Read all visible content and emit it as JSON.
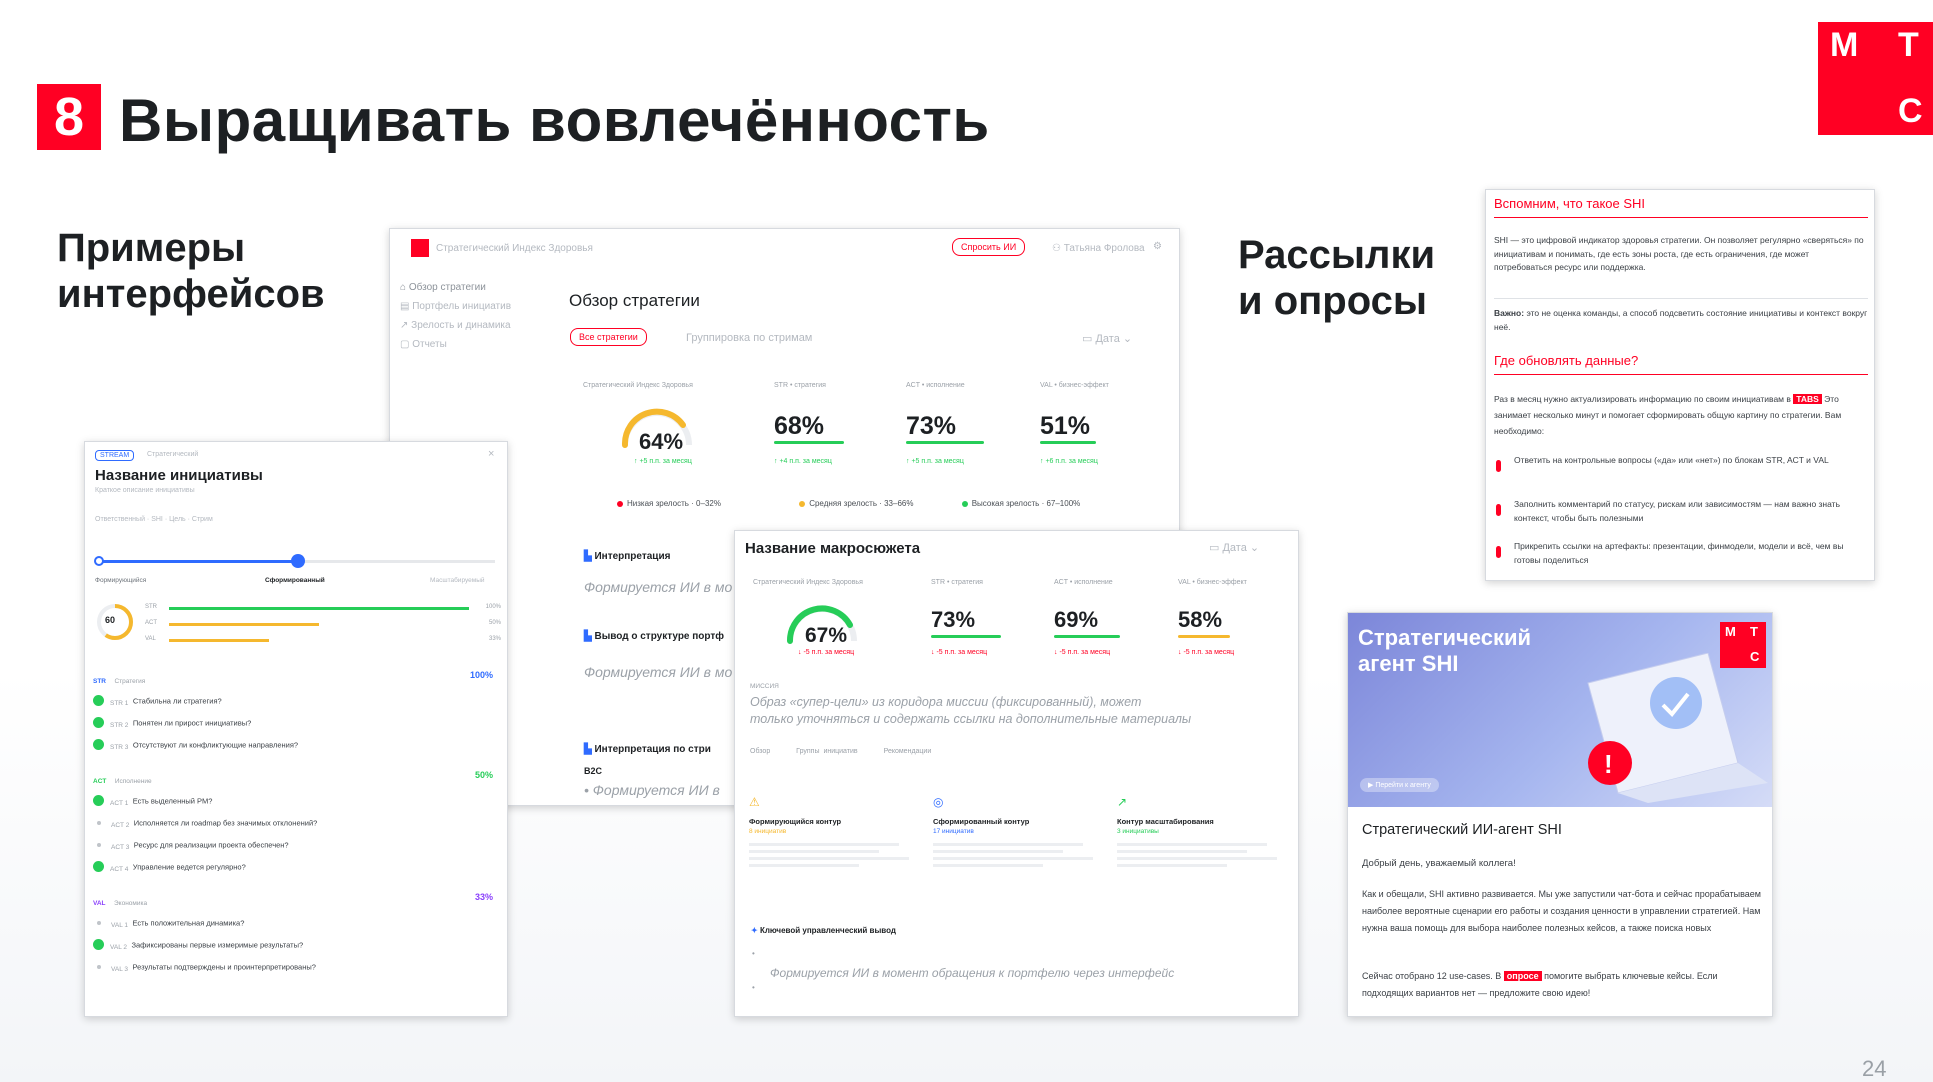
{
  "slide": {
    "number": "8",
    "title": "Выращивать вовлечённость",
    "section_interfaces": [
      "Примеры",
      "интерфейсов"
    ],
    "section_mailings": [
      "Рассылки",
      "и опросы"
    ],
    "page_number": "24",
    "logo_letters": [
      "М",
      "Т",
      "С"
    ]
  },
  "dashboard": {
    "app_title": "Стратегический Индекс Здоровья",
    "ask_button": "Спросить ИИ",
    "user": "Татьяна Фролова",
    "nav": [
      "Обзор стратегии",
      "Портфель инициатив",
      "Зрелость и динамика",
      "Отчеты"
    ],
    "page_title": "Обзор стратегии",
    "tab_active": "Все стратегии",
    "tab_other": "Группировка по стримам",
    "date_filter": "Дата",
    "metrics": [
      {
        "label": "Стратегический Индекс Здоровья",
        "value": "64%",
        "delta": "↑ +5 п.п. за месяц"
      },
      {
        "label": "STR • стратегия",
        "value": "68%",
        "delta": "↑ +4 п.п. за месяц"
      },
      {
        "label": "ACT • исполнение",
        "value": "73%",
        "delta": "↑ +5 п.п. за месяц"
      },
      {
        "label": "VAL • бизнес-эффект",
        "value": "51%",
        "delta": "↑ +6 п.п. за месяц"
      }
    ],
    "legend": [
      {
        "label": "Низкая зрелость · 0–32%",
        "color": "#ff0023"
      },
      {
        "label": "Средняя зрелость · 33–66%",
        "color": "#f5b82e"
      },
      {
        "label": "Высокая зрелость · 67–100%",
        "color": "#26cd58"
      }
    ],
    "sections": [
      {
        "title": "Интерпретация",
        "text": "Формируется ИИ в мо"
      },
      {
        "title": "Вывод о структуре портф",
        "text": "Формируется ИИ в мо"
      },
      {
        "title": "Интерпретация по стри",
        "sub": "B2C",
        "text": "Формируется ИИ в"
      }
    ]
  },
  "initiative": {
    "tag": "STREAM",
    "tag2": "Стратегический",
    "title": "Название инициативы",
    "subtitle": "Краткое описание инициативы",
    "meta": "Ответственный · SHI · Цель · Стрим",
    "slider_labels": [
      "Формирующийся",
      "Сформированный",
      "Масштабируемый"
    ],
    "gauge_value": "60",
    "bars": [
      {
        "label": "STR",
        "value": "100%",
        "color": "#26cd58",
        "fill": 1.0
      },
      {
        "label": "ACT",
        "value": "50%",
        "color": "#f5b82e",
        "fill": 0.5
      },
      {
        "label": "VAL",
        "value": "33%",
        "color": "#f5b82e",
        "fill": 0.33
      }
    ],
    "groups": [
      {
        "code": "STR",
        "name": "Стратегия",
        "score": "100%",
        "color": "#2f6bff",
        "items": [
          {
            "done": true,
            "code": "STR 1",
            "text": "Стабильна ли стратегия?"
          },
          {
            "done": true,
            "code": "STR 2",
            "text": "Понятен ли прирост инициативы?"
          },
          {
            "done": true,
            "code": "STR 3",
            "text": "Отсутствуют ли конфликтующие направления?"
          }
        ]
      },
      {
        "code": "ACT",
        "name": "Исполнение",
        "score": "50%",
        "color": "#26cd58",
        "items": [
          {
            "done": true,
            "code": "ACT 1",
            "text": "Есть выделенный PM?"
          },
          {
            "done": false,
            "code": "ACT 2",
            "text": "Исполняется ли roadmap без значимых отклонений?"
          },
          {
            "done": false,
            "code": "ACT 3",
            "text": "Ресурс для реализации проекта обеспечен?"
          },
          {
            "done": true,
            "code": "ACT 4",
            "text": "Управление ведется регулярно?"
          }
        ]
      },
      {
        "code": "VAL",
        "name": "Экономика",
        "score": "33%",
        "color": "#8a3ffc",
        "items": [
          {
            "done": false,
            "code": "VAL 1",
            "text": "Есть положительная динамика?"
          },
          {
            "done": true,
            "code": "VAL 2",
            "text": "Зафиксированы первые измеримые результаты?"
          },
          {
            "done": false,
            "code": "VAL 3",
            "text": "Результаты подтверждены и проинтерпретированы?"
          }
        ]
      }
    ]
  },
  "macro": {
    "title": "Название макросюжета",
    "date_filter": "Дата",
    "metrics": [
      {
        "label": "Стратегический Индекс Здоровья",
        "value": "67%",
        "delta": "↓ -5 п.п. за месяц"
      },
      {
        "label": "STR • стратегия",
        "value": "73%",
        "delta": "↓ -5 п.п. за месяц"
      },
      {
        "label": "ACT • исполнение",
        "value": "69%",
        "delta": "↓ -5 п.п. за месяц"
      },
      {
        "label": "VAL • бизнес-эффект",
        "value": "58%",
        "delta": "↓ -5 п.п. за месяц"
      }
    ],
    "mission_label": "МИССИЯ",
    "mission_text_1": "Образ «супер-цели» из коридора миссии (фиксированный), может",
    "mission_text_2": "только уточняться и содержать ссылки на дополнительные материалы",
    "tabs": [
      "Обзор",
      "Группы инициатив",
      "Рекомендации"
    ],
    "columns": [
      {
        "title": "Формирующийся контур",
        "count": "8 инициатив",
        "color": "#f5b82e",
        "icon": "⚠"
      },
      {
        "title": "Сформированный контур",
        "count": "17 инициатив",
        "color": "#2f6bff",
        "icon": "◎"
      },
      {
        "title": "Контур масштабирования",
        "count": "3 инициативы",
        "color": "#26cd58",
        "icon": "↗"
      }
    ],
    "key_output": "Ключевой управленческий вывод",
    "ai_text": "Формируется ИИ в момент обращения к портфелю через интерфейс"
  },
  "memo": {
    "h1": "Вспомним, что такое SHI",
    "p1": "SHI — это цифровой индикатор здоровья стратегии. Он позволяет регулярно «сверяться» по инициативам и понимать, где есть зоны роста, где есть ограничения, где может потребоваться ресурс или поддержка.",
    "p2_bold": "Важно:",
    "p2": "это не оценка команды, а способ подсветить состояние инициативы и контекст вокруг неё.",
    "h2": "Где обновлять данные?",
    "p3a": "Раз в месяц нужно актуализировать информацию по своим инициативам в",
    "tabs_tag": "TABS",
    "p3b": "Это занимает несколько минут и помогает сформировать общую картину по стратегии. Вам необходимо:",
    "items": [
      "Ответить на контрольные вопросы («да» или «нет») по блокам STR, ACT и VAL",
      "Заполнить комментарий по статусу, рискам или зависимостям — нам важно знать контекст, чтобы быть полезными",
      "Прикрепить ссылки на артефакты: презентации, финмодели, модели и всё, чем вы готовы поделиться"
    ]
  },
  "mail": {
    "banner_title_1": "Стратегический",
    "banner_title_2": "агент SHI",
    "banner_button": "Перейти к агенту",
    "heading": "Стратегический ИИ-агент SHI",
    "greeting": "Добрый день, уважаемый коллега!",
    "p1": "Как и обещали, SHI активно развивается. Мы уже запустили чат-бота и сейчас прорабатываем наиболее вероятные сценарии его работы и создания ценности в управлении стратегией. Нам нужна ваша помощь для выбора наиболее полезных кейсов, а также поиска новых",
    "p2a": "Сейчас отобрано 12 use-cases. В",
    "survey_tag": "опросе",
    "p2b": "помогите выбрать ключевые кейсы. Если подходящих вариантов нет — предложите свою идею!"
  }
}
